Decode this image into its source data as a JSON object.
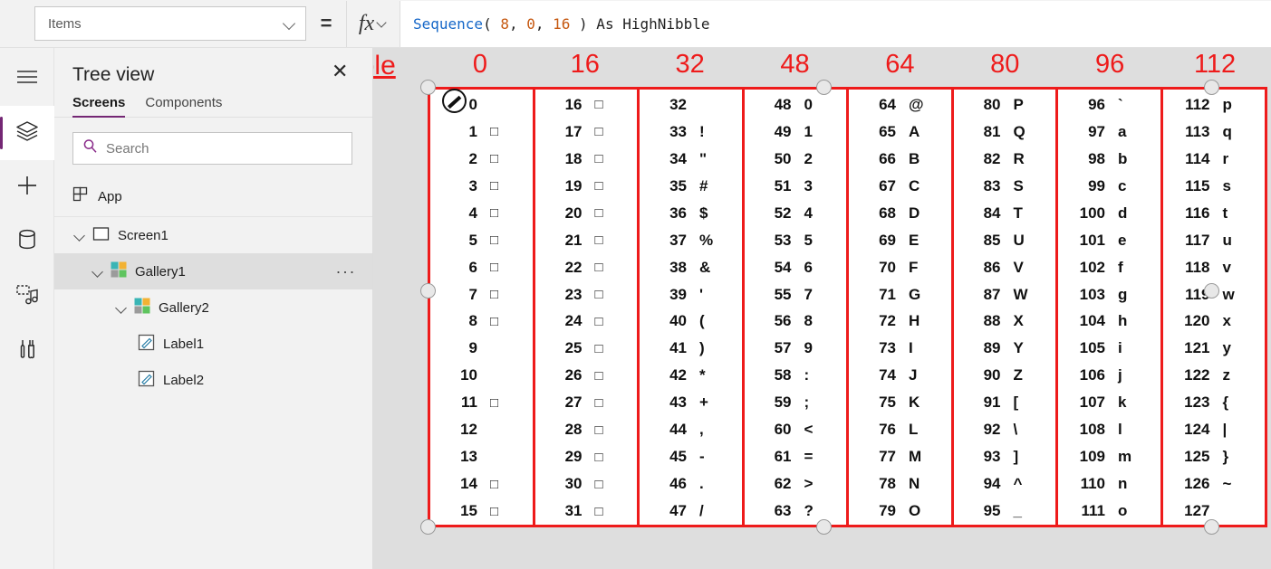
{
  "formula_bar": {
    "property_value": "Items",
    "property_placeholder": "Items",
    "equals_sign": "=",
    "fx_label": "fx",
    "formula_tokens": [
      {
        "text": "Sequence",
        "kind": "fn"
      },
      {
        "text": "( ",
        "kind": "plain"
      },
      {
        "text": "8",
        "kind": "num"
      },
      {
        "text": ", ",
        "kind": "plain"
      },
      {
        "text": "0",
        "kind": "num"
      },
      {
        "text": ", ",
        "kind": "plain"
      },
      {
        "text": "16",
        "kind": "num"
      },
      {
        "text": " ) As HighNibble",
        "kind": "plain"
      }
    ],
    "formula_text": "Sequence( 8, 0, 16 ) As HighNibble"
  },
  "rail": {
    "items": [
      {
        "icon": "hamburger-menu-icon",
        "name": "menu",
        "active": false
      },
      {
        "icon": "layers-icon",
        "name": "tree-view",
        "active": true
      },
      {
        "icon": "plus-icon",
        "name": "insert",
        "active": false
      },
      {
        "icon": "database-icon",
        "name": "data",
        "active": false
      },
      {
        "icon": "media-icon",
        "name": "media",
        "active": false
      },
      {
        "icon": "tools-icon",
        "name": "advanced",
        "active": false
      }
    ]
  },
  "tree_panel": {
    "title": "Tree view",
    "tabs": [
      {
        "label": "Screens",
        "active": true
      },
      {
        "label": "Components",
        "active": false
      }
    ],
    "search": {
      "placeholder": "Search",
      "value": ""
    },
    "items": [
      {
        "label": "App",
        "indent": 0,
        "caret": false,
        "icon": "app-icon",
        "selected": false,
        "menu": false
      },
      {
        "label": "Screen1",
        "indent": 1,
        "caret": true,
        "icon": "screen-icon",
        "selected": false,
        "menu": false
      },
      {
        "label": "Gallery1",
        "indent": 2,
        "caret": true,
        "icon": "gallery-icon",
        "selected": true,
        "menu": true
      },
      {
        "label": "Gallery2",
        "indent": 3,
        "caret": true,
        "icon": "gallery-icon",
        "selected": false,
        "menu": false
      },
      {
        "label": "Label1",
        "indent": 4,
        "caret": false,
        "icon": "label-icon",
        "selected": false,
        "menu": false
      },
      {
        "label": "Label2",
        "indent": 4,
        "caret": false,
        "icon": "label-icon",
        "selected": false,
        "menu": false
      }
    ],
    "menu_dots": "···"
  },
  "canvas": {
    "annotation_label": "HighNibble",
    "annotation_color": "#ee1b1b",
    "column_headers": [
      "0",
      "16",
      "32",
      "48",
      "64",
      "80",
      "96",
      "112"
    ],
    "columns": [
      {
        "header": "0",
        "rows": [
          {
            "num": "0",
            "char": "",
            "box": false
          },
          {
            "num": "1",
            "char": "□",
            "box": true
          },
          {
            "num": "2",
            "char": "□",
            "box": true
          },
          {
            "num": "3",
            "char": "□",
            "box": true
          },
          {
            "num": "4",
            "char": "□",
            "box": true
          },
          {
            "num": "5",
            "char": "□",
            "box": true
          },
          {
            "num": "6",
            "char": "□",
            "box": true
          },
          {
            "num": "7",
            "char": "□",
            "box": true
          },
          {
            "num": "8",
            "char": "□",
            "box": true
          },
          {
            "num": "9",
            "char": "",
            "box": false
          },
          {
            "num": "10",
            "char": "",
            "box": false
          },
          {
            "num": "11",
            "char": "□",
            "box": true
          },
          {
            "num": "12",
            "char": "",
            "box": false
          },
          {
            "num": "13",
            "char": "",
            "box": false
          },
          {
            "num": "14",
            "char": "□",
            "box": true
          },
          {
            "num": "15",
            "char": "□",
            "box": true
          }
        ]
      },
      {
        "header": "16",
        "rows": [
          {
            "num": "16",
            "char": "□",
            "box": true
          },
          {
            "num": "17",
            "char": "□",
            "box": true
          },
          {
            "num": "18",
            "char": "□",
            "box": true
          },
          {
            "num": "19",
            "char": "□",
            "box": true
          },
          {
            "num": "20",
            "char": "□",
            "box": true
          },
          {
            "num": "21",
            "char": "□",
            "box": true
          },
          {
            "num": "22",
            "char": "□",
            "box": true
          },
          {
            "num": "23",
            "char": "□",
            "box": true
          },
          {
            "num": "24",
            "char": "□",
            "box": true
          },
          {
            "num": "25",
            "char": "□",
            "box": true
          },
          {
            "num": "26",
            "char": "□",
            "box": true
          },
          {
            "num": "27",
            "char": "□",
            "box": true
          },
          {
            "num": "28",
            "char": "□",
            "box": true
          },
          {
            "num": "29",
            "char": "□",
            "box": true
          },
          {
            "num": "30",
            "char": "□",
            "box": true
          },
          {
            "num": "31",
            "char": "□",
            "box": true
          }
        ]
      },
      {
        "header": "32",
        "rows": [
          {
            "num": "32",
            "char": "",
            "box": false
          },
          {
            "num": "33",
            "char": "!",
            "box": false
          },
          {
            "num": "34",
            "char": "\"",
            "box": false
          },
          {
            "num": "35",
            "char": "#",
            "box": false
          },
          {
            "num": "36",
            "char": "$",
            "box": false
          },
          {
            "num": "37",
            "char": "%",
            "box": false
          },
          {
            "num": "38",
            "char": "&",
            "box": false
          },
          {
            "num": "39",
            "char": "'",
            "box": false
          },
          {
            "num": "40",
            "char": "(",
            "box": false
          },
          {
            "num": "41",
            "char": ")",
            "box": false
          },
          {
            "num": "42",
            "char": "*",
            "box": false
          },
          {
            "num": "43",
            "char": "+",
            "box": false
          },
          {
            "num": "44",
            "char": ",",
            "box": false
          },
          {
            "num": "45",
            "char": "-",
            "box": false
          },
          {
            "num": "46",
            "char": ".",
            "box": false
          },
          {
            "num": "47",
            "char": "/",
            "box": false
          }
        ]
      },
      {
        "header": "48",
        "rows": [
          {
            "num": "48",
            "char": "0",
            "box": false
          },
          {
            "num": "49",
            "char": "1",
            "box": false
          },
          {
            "num": "50",
            "char": "2",
            "box": false
          },
          {
            "num": "51",
            "char": "3",
            "box": false
          },
          {
            "num": "52",
            "char": "4",
            "box": false
          },
          {
            "num": "53",
            "char": "5",
            "box": false
          },
          {
            "num": "54",
            "char": "6",
            "box": false
          },
          {
            "num": "55",
            "char": "7",
            "box": false
          },
          {
            "num": "56",
            "char": "8",
            "box": false
          },
          {
            "num": "57",
            "char": "9",
            "box": false
          },
          {
            "num": "58",
            "char": ":",
            "box": false
          },
          {
            "num": "59",
            "char": ";",
            "box": false
          },
          {
            "num": "60",
            "char": "<",
            "box": false
          },
          {
            "num": "61",
            "char": "=",
            "box": false
          },
          {
            "num": "62",
            "char": ">",
            "box": false
          },
          {
            "num": "63",
            "char": "?",
            "box": false
          }
        ]
      },
      {
        "header": "64",
        "rows": [
          {
            "num": "64",
            "char": "@",
            "box": false
          },
          {
            "num": "65",
            "char": "A",
            "box": false
          },
          {
            "num": "66",
            "char": "B",
            "box": false
          },
          {
            "num": "67",
            "char": "C",
            "box": false
          },
          {
            "num": "68",
            "char": "D",
            "box": false
          },
          {
            "num": "69",
            "char": "E",
            "box": false
          },
          {
            "num": "70",
            "char": "F",
            "box": false
          },
          {
            "num": "71",
            "char": "G",
            "box": false
          },
          {
            "num": "72",
            "char": "H",
            "box": false
          },
          {
            "num": "73",
            "char": "I",
            "box": false
          },
          {
            "num": "74",
            "char": "J",
            "box": false
          },
          {
            "num": "75",
            "char": "K",
            "box": false
          },
          {
            "num": "76",
            "char": "L",
            "box": false
          },
          {
            "num": "77",
            "char": "M",
            "box": false
          },
          {
            "num": "78",
            "char": "N",
            "box": false
          },
          {
            "num": "79",
            "char": "O",
            "box": false
          }
        ]
      },
      {
        "header": "80",
        "rows": [
          {
            "num": "80",
            "char": "P",
            "box": false
          },
          {
            "num": "81",
            "char": "Q",
            "box": false
          },
          {
            "num": "82",
            "char": "R",
            "box": false
          },
          {
            "num": "83",
            "char": "S",
            "box": false
          },
          {
            "num": "84",
            "char": "T",
            "box": false
          },
          {
            "num": "85",
            "char": "U",
            "box": false
          },
          {
            "num": "86",
            "char": "V",
            "box": false
          },
          {
            "num": "87",
            "char": "W",
            "box": false
          },
          {
            "num": "88",
            "char": "X",
            "box": false
          },
          {
            "num": "89",
            "char": "Y",
            "box": false
          },
          {
            "num": "90",
            "char": "Z",
            "box": false
          },
          {
            "num": "91",
            "char": "[",
            "box": false
          },
          {
            "num": "92",
            "char": "\\",
            "box": false
          },
          {
            "num": "93",
            "char": "]",
            "box": false
          },
          {
            "num": "94",
            "char": "^",
            "box": false
          },
          {
            "num": "95",
            "char": "_",
            "box": false
          }
        ]
      },
      {
        "header": "96",
        "rows": [
          {
            "num": "96",
            "char": "`",
            "box": false
          },
          {
            "num": "97",
            "char": "a",
            "box": false
          },
          {
            "num": "98",
            "char": "b",
            "box": false
          },
          {
            "num": "99",
            "char": "c",
            "box": false
          },
          {
            "num": "100",
            "char": "d",
            "box": false
          },
          {
            "num": "101",
            "char": "e",
            "box": false
          },
          {
            "num": "102",
            "char": "f",
            "box": false
          },
          {
            "num": "103",
            "char": "g",
            "box": false
          },
          {
            "num": "104",
            "char": "h",
            "box": false
          },
          {
            "num": "105",
            "char": "i",
            "box": false
          },
          {
            "num": "106",
            "char": "j",
            "box": false
          },
          {
            "num": "107",
            "char": "k",
            "box": false
          },
          {
            "num": "108",
            "char": "l",
            "box": false
          },
          {
            "num": "109",
            "char": "m",
            "box": false
          },
          {
            "num": "110",
            "char": "n",
            "box": false
          },
          {
            "num": "111",
            "char": "o",
            "box": false
          }
        ]
      },
      {
        "header": "112",
        "rows": [
          {
            "num": "112",
            "char": "p",
            "box": false
          },
          {
            "num": "113",
            "char": "q",
            "box": false
          },
          {
            "num": "114",
            "char": "r",
            "box": false
          },
          {
            "num": "115",
            "char": "s",
            "box": false
          },
          {
            "num": "116",
            "char": "t",
            "box": false
          },
          {
            "num": "117",
            "char": "u",
            "box": false
          },
          {
            "num": "118",
            "char": "v",
            "box": false
          },
          {
            "num": "119",
            "char": "w",
            "box": false
          },
          {
            "num": "120",
            "char": "x",
            "box": false
          },
          {
            "num": "121",
            "char": "y",
            "box": false
          },
          {
            "num": "122",
            "char": "z",
            "box": false
          },
          {
            "num": "123",
            "char": "{",
            "box": false
          },
          {
            "num": "124",
            "char": "|",
            "box": false
          },
          {
            "num": "125",
            "char": "}",
            "box": false
          },
          {
            "num": "126",
            "char": "~",
            "box": false
          },
          {
            "num": "127",
            "char": "",
            "box": false
          }
        ]
      }
    ]
  }
}
